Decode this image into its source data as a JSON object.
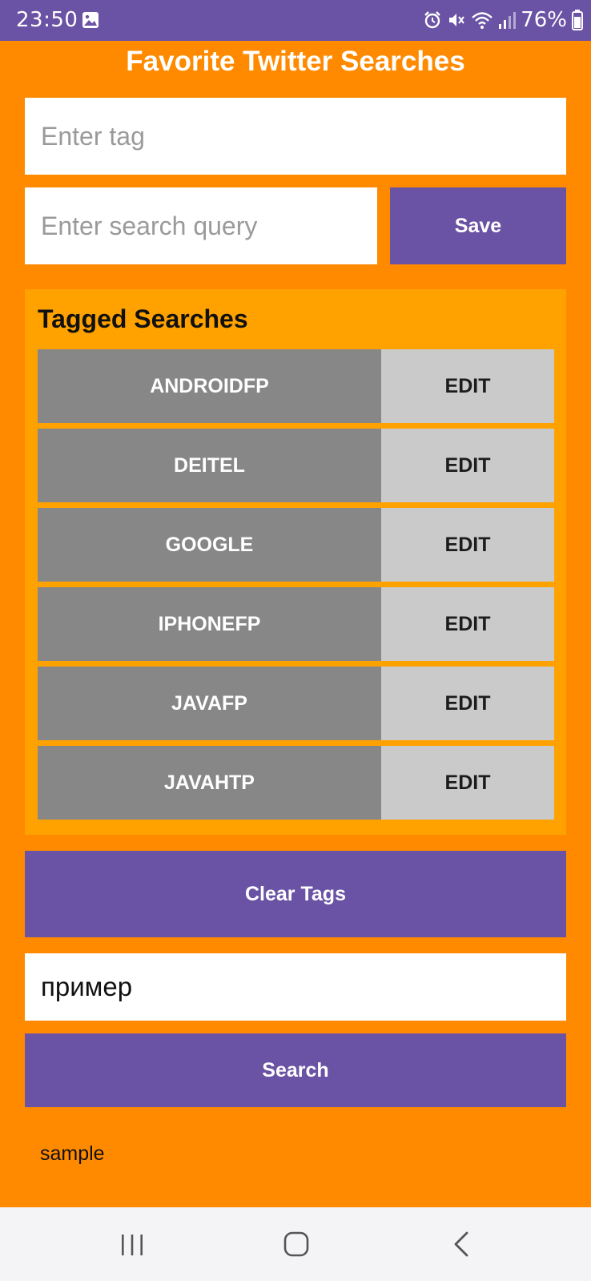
{
  "status_bar": {
    "time": "23:50",
    "battery": "76%",
    "icons": [
      "gallery-icon",
      "alarm-icon",
      "mute-icon",
      "wifi-icon",
      "signal-icon",
      "battery-icon"
    ]
  },
  "app": {
    "title": "Favorite Twitter Searches"
  },
  "form": {
    "tag_placeholder": "Enter tag",
    "query_placeholder": "Enter search query",
    "save_label": "Save"
  },
  "tagged": {
    "title": "Tagged Searches",
    "edit_label": "EDIT",
    "tags": [
      "ANDROIDFP",
      "DEITEL",
      "GOOGLE",
      "IPHONEFP",
      "JAVAFP",
      "JAVAHTP"
    ]
  },
  "clear_label": "Clear Tags",
  "search": {
    "value": "пример",
    "button_label": "Search",
    "result": "sample"
  },
  "nav": {
    "icons": [
      "recent-apps-icon",
      "home-icon",
      "back-icon"
    ]
  },
  "colors": {
    "status_bar": "#6a52a4",
    "background": "#ff8a00",
    "panel": "#ffa200",
    "button": "#6a52a4",
    "tag_button": "#878787",
    "edit_button": "#cacaca"
  }
}
